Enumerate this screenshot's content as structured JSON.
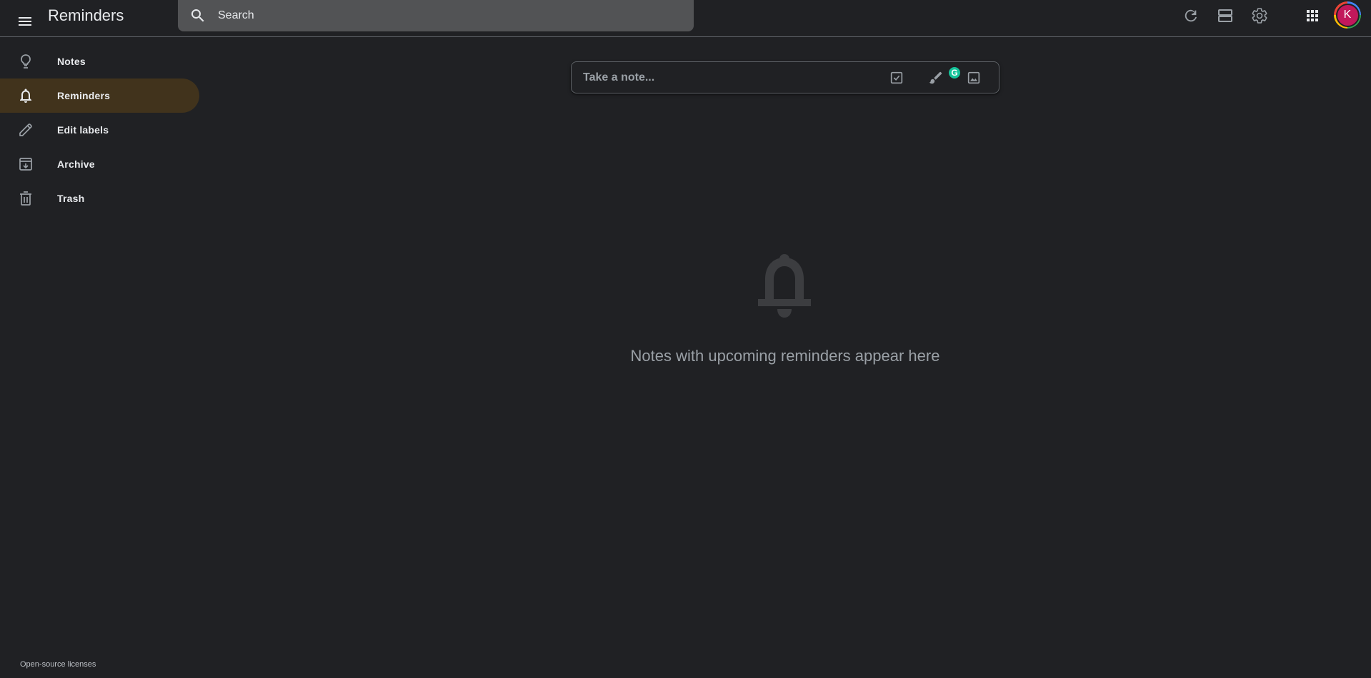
{
  "header": {
    "menu_icon": "hamburger-menu-icon",
    "title": "Reminders",
    "search_placeholder": "Search",
    "search_icon": "search-icon",
    "actions": [
      {
        "name": "refresh-button",
        "icon": "refresh-icon"
      },
      {
        "name": "list-view-button",
        "icon": "list-view-icon"
      },
      {
        "name": "settings-button",
        "icon": "gear-icon"
      },
      {
        "name": "apps-button",
        "icon": "apps-grid-icon"
      }
    ],
    "avatar_letter": "K"
  },
  "sidebar": {
    "items": [
      {
        "label": "Notes",
        "icon": "lightbulb-icon",
        "active": false
      },
      {
        "label": "Reminders",
        "icon": "bell-icon",
        "active": true
      },
      {
        "label": "Edit labels",
        "icon": "pencil-icon",
        "active": false
      },
      {
        "label": "Archive",
        "icon": "archive-icon",
        "active": false
      },
      {
        "label": "Trash",
        "icon": "trash-icon",
        "active": false
      }
    ],
    "footer_link": "Open-source licenses"
  },
  "note_input": {
    "placeholder": "Take a note...",
    "actions": [
      {
        "name": "new-list-button",
        "icon": "checkbox-icon"
      },
      {
        "name": "new-drawing-button",
        "icon": "brush-icon"
      },
      {
        "name": "new-image-button",
        "icon": "image-icon"
      }
    ],
    "grammarly_badge": "G"
  },
  "empty_state": {
    "icon": "bell-icon",
    "message": "Notes with upcoming reminders appear here"
  },
  "colors": {
    "background": "#202124",
    "active_item": "#41331c",
    "search_bg": "#525355",
    "avatar": "#c2185b",
    "grammarly": "#15c39a"
  }
}
